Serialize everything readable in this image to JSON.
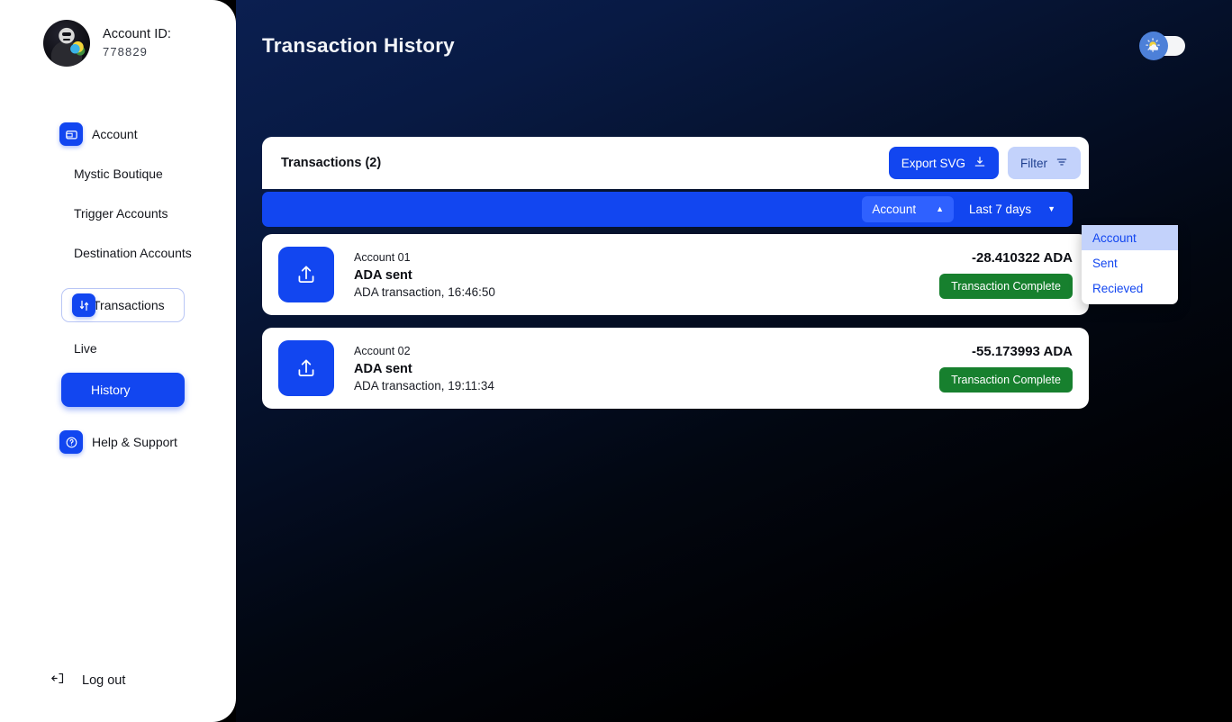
{
  "sidebar": {
    "account_label": "Account ID:",
    "account_id": "778829",
    "avatar_icon": "anonymous-mask-avatar",
    "items": [
      {
        "label": "Account",
        "icon": "wallet-icon",
        "style": "icon"
      },
      {
        "label": "Mystic Boutique",
        "style": "plain"
      },
      {
        "label": "Trigger Accounts",
        "style": "plain"
      },
      {
        "label": "Destination Accounts",
        "style": "plain"
      },
      {
        "label": "Transactions",
        "icon": "transfer-icon",
        "style": "boxed"
      },
      {
        "label": "Live",
        "style": "plain"
      },
      {
        "label": "History",
        "style": "active"
      },
      {
        "label": "Help & Support",
        "icon": "question-icon",
        "style": "icon"
      }
    ],
    "logout_label": "Log out",
    "logout_icon": "logout-icon"
  },
  "header": {
    "title": "Transaction History",
    "theme_toggle_icon": "sun-cloud-icon",
    "theme_toggle_state": "off"
  },
  "toolbar": {
    "title": "Transactions (2)",
    "export_label": "Export SVG",
    "export_icon": "download-icon",
    "filter_label": "Filter",
    "filter_icon": "filter-icon"
  },
  "filters": {
    "account_select": {
      "value": "Account",
      "expanded": true,
      "caret_icon": "chevron-up-icon",
      "options": [
        "Account",
        "Sent",
        "Recieved"
      ],
      "selected_index": 0
    },
    "range_select": {
      "value": "Last 7 days",
      "caret_icon": "chevron-down-icon"
    }
  },
  "transactions": [
    {
      "account": "Account 01",
      "kind": "ADA sent",
      "detail": "ADA transaction, 16:46:50",
      "amount": "-28.410322 ADA",
      "status": "Transaction Complete",
      "icon": "upload-icon"
    },
    {
      "account": "Account 02",
      "kind": "ADA sent",
      "detail": "ADA transaction, 19:11:34",
      "amount": "-55.173993 ADA",
      "status": "Transaction Complete",
      "icon": "upload-icon"
    }
  ],
  "colors": {
    "brand_blue": "#1246f0",
    "status_green": "#17802e",
    "light_blue": "#c3d2fb",
    "navy_bg": "#0b1f50"
  }
}
